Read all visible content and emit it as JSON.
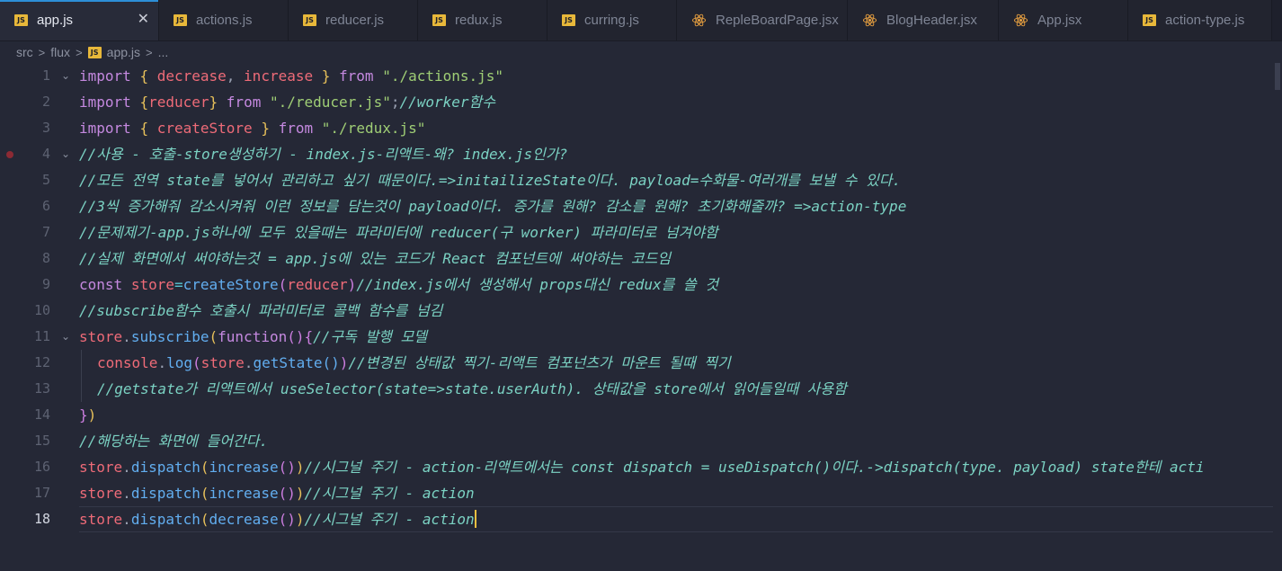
{
  "tabs": [
    {
      "label": "app.js",
      "icon": "js-icon",
      "active": true,
      "close": "✕",
      "width": 144
    },
    {
      "label": "actions.js",
      "icon": "js-icon",
      "active": false,
      "width": 144
    },
    {
      "label": "reducer.js",
      "icon": "js-icon",
      "active": false,
      "width": 144
    },
    {
      "label": "redux.js",
      "icon": "js-icon",
      "active": false,
      "width": 144
    },
    {
      "label": "curring.js",
      "icon": "js-icon",
      "active": false,
      "width": 144
    },
    {
      "label": "RepleBoardPage.jsx",
      "icon": "react-icon",
      "active": false,
      "width": 190
    },
    {
      "label": "BlogHeader.jsx",
      "icon": "react-icon",
      "active": false,
      "width": 168
    },
    {
      "label": "App.jsx",
      "icon": "react-icon",
      "active": false,
      "width": 144
    },
    {
      "label": "action-type.js",
      "icon": "js-icon",
      "active": false,
      "width": 160
    }
  ],
  "breadcrumb": {
    "parts": [
      "src",
      "flux",
      "app.js",
      "..."
    ],
    "separator": ">"
  },
  "editor": {
    "current_line": 18,
    "lines": [
      {
        "n": "1",
        "fold": true,
        "tokens": [
          [
            "kw",
            "import"
          ],
          [
            "pn",
            " "
          ],
          [
            "br",
            "{"
          ],
          [
            "pn",
            " "
          ],
          [
            "var",
            "decrease"
          ],
          [
            "pn",
            ", "
          ],
          [
            "var",
            "increase"
          ],
          [
            "pn",
            " "
          ],
          [
            "br",
            "}"
          ],
          [
            "pn",
            " "
          ],
          [
            "kw",
            "from"
          ],
          [
            "pn",
            " "
          ],
          [
            "str",
            "\"./actions.js\""
          ]
        ]
      },
      {
        "n": "2",
        "tokens": [
          [
            "kw",
            "import"
          ],
          [
            "pn",
            " "
          ],
          [
            "br",
            "{"
          ],
          [
            "var",
            "reducer"
          ],
          [
            "br",
            "}"
          ],
          [
            "pn",
            " "
          ],
          [
            "kw",
            "from"
          ],
          [
            "pn",
            " "
          ],
          [
            "str",
            "\"./reducer.js\""
          ],
          [
            "pn",
            ";"
          ],
          [
            "cm",
            "//worker함수"
          ]
        ]
      },
      {
        "n": "3",
        "tokens": [
          [
            "kw",
            "import"
          ],
          [
            "pn",
            " "
          ],
          [
            "br",
            "{"
          ],
          [
            "pn",
            " "
          ],
          [
            "var",
            "createStore"
          ],
          [
            "pn",
            " "
          ],
          [
            "br",
            "}"
          ],
          [
            "pn",
            " "
          ],
          [
            "kw",
            "from"
          ],
          [
            "pn",
            " "
          ],
          [
            "str",
            "\"./redux.js\""
          ]
        ]
      },
      {
        "n": "4",
        "fold": true,
        "breakpoint": true,
        "tokens": [
          [
            "cm",
            "//사용 - 호출-store생성하기 - index.js-리액트-왜? index.js인가?"
          ]
        ]
      },
      {
        "n": "5",
        "tokens": [
          [
            "cm",
            "//모든 전역 state를 넣어서 관리하고 싶기 때문이다.=>initailizeState이다. payload=수화물-여러개를 보낼 수 있다."
          ]
        ]
      },
      {
        "n": "6",
        "tokens": [
          [
            "cm",
            "//3씩 증가해줘 감소시켜줘 이런 정보를 담는것이 payload이다. 증가를 원해? 감소를 원해? 초기화해줄까? =>action-type"
          ]
        ]
      },
      {
        "n": "7",
        "tokens": [
          [
            "cm",
            "//문제제기-app.js하나에 모두 있을때는 파라미터에 reducer(구 worker) 파라미터로 넘겨야함"
          ]
        ]
      },
      {
        "n": "8",
        "tokens": [
          [
            "cm",
            "//실제 화면에서 써야하는것 = app.js에 있는 코드가 React 컴포넌트에 써야하는 코드임"
          ]
        ]
      },
      {
        "n": "9",
        "tokens": [
          [
            "kw",
            "const"
          ],
          [
            "pn",
            " "
          ],
          [
            "var",
            "store"
          ],
          [
            "op",
            "="
          ],
          [
            "fn",
            "createStore"
          ],
          [
            "br2",
            "("
          ],
          [
            "var",
            "reducer"
          ],
          [
            "br2",
            ")"
          ],
          [
            "cm",
            "//index.js에서 생성해서 props대신 redux를 쓸 것"
          ]
        ]
      },
      {
        "n": "10",
        "tokens": [
          [
            "cm",
            "//subscribe함수 호출시 파라미터로 콜백 함수를 넘김"
          ]
        ]
      },
      {
        "n": "11",
        "fold": true,
        "tokens": [
          [
            "var",
            "store"
          ],
          [
            "pn",
            "."
          ],
          [
            "fn",
            "subscribe"
          ],
          [
            "br",
            "("
          ],
          [
            "kw",
            "function"
          ],
          [
            "br2",
            "()"
          ],
          [
            "br2",
            "{"
          ],
          [
            "cm",
            "//구독 발행 모델"
          ]
        ]
      },
      {
        "n": "12",
        "indent": true,
        "tokens": [
          [
            "var",
            "console"
          ],
          [
            "pn",
            "."
          ],
          [
            "fn",
            "log"
          ],
          [
            "br2",
            "("
          ],
          [
            "var",
            "store"
          ],
          [
            "pn",
            "."
          ],
          [
            "fn",
            "getState"
          ],
          [
            "fn",
            "()"
          ],
          [
            "br2",
            ")"
          ],
          [
            "cm",
            "//변경된 상태값 찍기-리액트 컴포넌츠가 마운트 될때 찍기"
          ]
        ]
      },
      {
        "n": "13",
        "indent": true,
        "tokens": [
          [
            "cm",
            "//getstate가 리액트에서 useSelector(state=>state.userAuth). 상태값을 store에서 읽어들일때 사용함"
          ]
        ]
      },
      {
        "n": "14",
        "tokens": [
          [
            "br2",
            "}"
          ],
          [
            "br",
            ")"
          ]
        ]
      },
      {
        "n": "15",
        "tokens": [
          [
            "cm",
            "//해당하는 화면에 들어간다."
          ]
        ]
      },
      {
        "n": "16",
        "tokens": [
          [
            "var",
            "store"
          ],
          [
            "pn",
            "."
          ],
          [
            "fn",
            "dispatch"
          ],
          [
            "br",
            "("
          ],
          [
            "fn",
            "increase"
          ],
          [
            "br2",
            "()"
          ],
          [
            "br",
            ")"
          ],
          [
            "cm",
            "//시그널 주기 - action-리액트에서는 const dispatch = useDispatch()이다.->dispatch(type. payload) state한테 acti"
          ]
        ]
      },
      {
        "n": "17",
        "tokens": [
          [
            "var",
            "store"
          ],
          [
            "pn",
            "."
          ],
          [
            "fn",
            "dispatch"
          ],
          [
            "br",
            "("
          ],
          [
            "fn",
            "increase"
          ],
          [
            "br2",
            "()"
          ],
          [
            "br",
            ")"
          ],
          [
            "cm",
            "//시그널 주기 - action"
          ]
        ]
      },
      {
        "n": "18",
        "cursor": true,
        "tokens": [
          [
            "var",
            "store"
          ],
          [
            "pn",
            "."
          ],
          [
            "fn",
            "dispatch"
          ],
          [
            "br",
            "("
          ],
          [
            "fn",
            "decrease"
          ],
          [
            "br2",
            "()"
          ],
          [
            "br",
            ")"
          ],
          [
            "cm",
            "//시그널 주기 - action"
          ]
        ]
      }
    ]
  },
  "colors": {
    "accent": "#2d8fd8",
    "background": "#252836",
    "tabbar": "#1e202c"
  }
}
